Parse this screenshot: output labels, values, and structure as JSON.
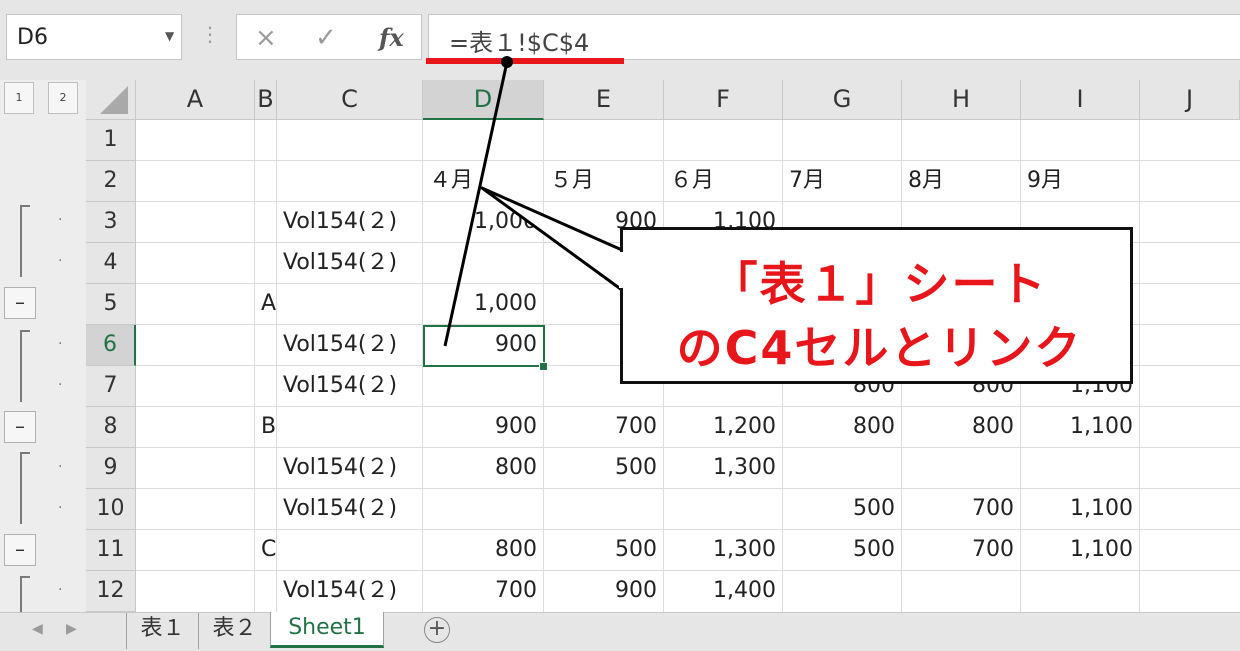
{
  "formula_bar": {
    "name_box": "D6",
    "cancel_symbol": "×",
    "enter_symbol": "✓",
    "fx_label": "fx",
    "formula": "=表１!$C$4"
  },
  "outline": {
    "levels": [
      "1",
      "2"
    ]
  },
  "columns": [
    "A",
    "B",
    "C",
    "D",
    "E",
    "F",
    "G",
    "H",
    "I",
    "J"
  ],
  "rows": [
    "1",
    "2",
    "3",
    "4",
    "5",
    "6",
    "7",
    "8",
    "9",
    "10",
    "11",
    "12"
  ],
  "cells": {
    "D2": "４月",
    "E2": "５月",
    "F2": "６月",
    "G2": "7月",
    "H2": "8月",
    "I2": "9月",
    "C3": "Vol154(２)",
    "D3": "1,000",
    "E3": "900",
    "F3": "1,100",
    "C4": "Vol154(２)",
    "B5": "A",
    "D5": "1,000",
    "C6": "Vol154(２)",
    "D6": "900",
    "C7": "Vol154(２)",
    "G7": "800",
    "H7": "800",
    "I7": "1,100",
    "B8": "B",
    "D8": "900",
    "E8": "700",
    "F8": "1,200",
    "G8": "800",
    "H8": "800",
    "I8": "1,100",
    "C9": "Vol154(２)",
    "D9": "800",
    "E9": "500",
    "F9": "1,300",
    "C10": "Vol154(２)",
    "G10": "500",
    "H10": "700",
    "I10": "1,100",
    "B11": "C",
    "D11": "800",
    "E11": "500",
    "F11": "1,300",
    "G11": "500",
    "H11": "700",
    "I11": "1,100",
    "C12": "Vol154(２)",
    "D12": "700",
    "E12": "900",
    "F12": "1,400"
  },
  "sheet_tabs": [
    "表１",
    "表２",
    "Sheet1"
  ],
  "active_sheet": "Sheet1",
  "callout": {
    "line1": "「表１」シート",
    "line2": "のC4セルとリンク"
  },
  "colors": {
    "accent_green": "#217346",
    "annotation_red": "#e8161b"
  }
}
